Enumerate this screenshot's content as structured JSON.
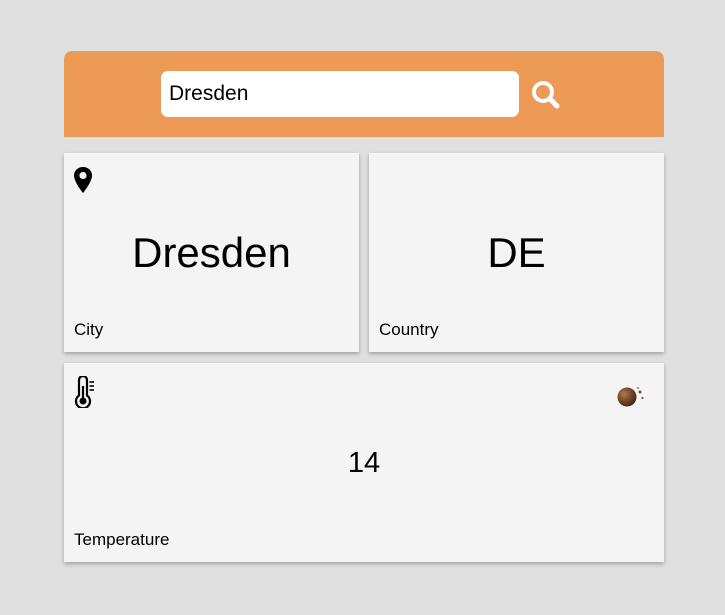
{
  "search": {
    "value": "Dresden",
    "icon": "search-icon"
  },
  "colors": {
    "header_bg": "#ec9a55",
    "page_bg": "#e0dfe0",
    "card_bg": "#f4f4f4"
  },
  "cards": {
    "city": {
      "value": "Dresden",
      "label": "City",
      "icon": "map-pin-icon"
    },
    "country": {
      "value": "DE",
      "label": "Country"
    },
    "temperature": {
      "value": "14",
      "label": "Temperature",
      "icon": "thermometer-icon",
      "weather_icon": "weather-condition-icon"
    }
  }
}
